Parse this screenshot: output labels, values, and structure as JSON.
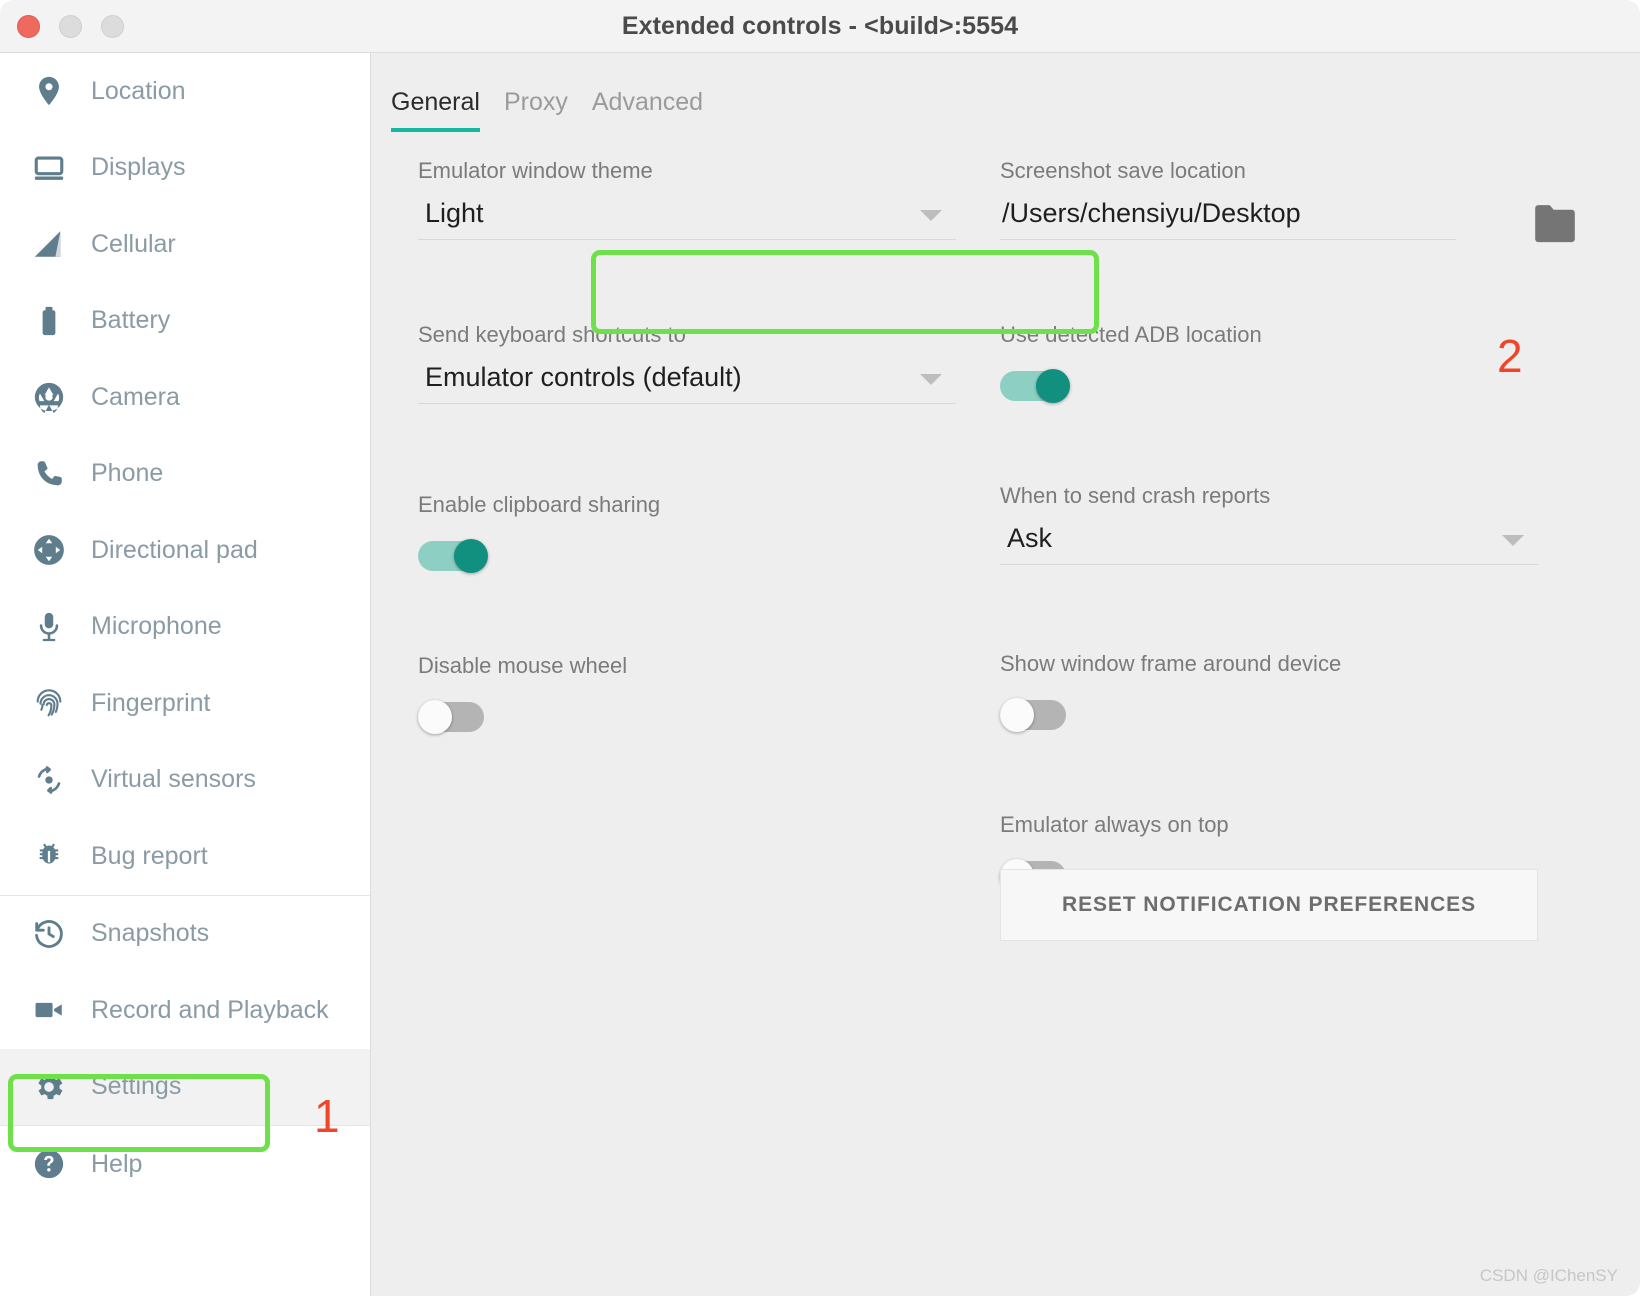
{
  "window": {
    "title": "Extended controls - <build>:5554",
    "traffic_lights": [
      "close-button",
      "minimize-button",
      "maximize-button"
    ]
  },
  "sidebar": {
    "groups": [
      {
        "items": [
          {
            "label": "Location",
            "icon": "location-pin-icon"
          },
          {
            "label": "Displays",
            "icon": "display-icon"
          },
          {
            "label": "Cellular",
            "icon": "cellular-signal-icon"
          },
          {
            "label": "Battery",
            "icon": "battery-icon"
          },
          {
            "label": "Camera",
            "icon": "camera-aperture-icon"
          },
          {
            "label": "Phone",
            "icon": "phone-icon"
          },
          {
            "label": "Directional pad",
            "icon": "dpad-icon"
          },
          {
            "label": "Microphone",
            "icon": "microphone-icon"
          },
          {
            "label": "Fingerprint",
            "icon": "fingerprint-icon"
          },
          {
            "label": "Virtual sensors",
            "icon": "virtual-sensors-icon"
          },
          {
            "label": "Bug report",
            "icon": "bug-icon"
          }
        ]
      },
      {
        "items": [
          {
            "label": "Snapshots",
            "icon": "history-clock-icon"
          },
          {
            "label": "Record and Playback",
            "icon": "video-camera-icon"
          },
          {
            "label": "Settings",
            "icon": "gear-icon",
            "selected": true
          }
        ]
      },
      {
        "items": [
          {
            "label": "Help",
            "icon": "help-question-icon"
          }
        ]
      }
    ]
  },
  "main": {
    "tabs": [
      {
        "label": "General",
        "active": true
      },
      {
        "label": "Proxy",
        "active": false
      },
      {
        "label": "Advanced",
        "active": false
      }
    ],
    "left_column": {
      "theme": {
        "label": "Emulator window theme",
        "value": "Light"
      },
      "keyboard_shortcuts": {
        "label": "Send keyboard shortcuts to",
        "value": "Emulator controls (default)"
      },
      "clipboard_sharing": {
        "label": "Enable clipboard sharing",
        "state": "on"
      },
      "disable_mouse_wheel": {
        "label": "Disable mouse wheel",
        "state": "off"
      }
    },
    "right_column": {
      "screenshot_location": {
        "label": "Screenshot save location",
        "value": "/Users/chensiyu/Desktop",
        "browse_icon": "folder-icon"
      },
      "adb_location": {
        "label": "Use detected ADB location",
        "state": "on"
      },
      "crash_reports": {
        "label": "When to send crash reports",
        "value": "Ask"
      },
      "window_frame": {
        "label": "Show window frame around device",
        "state": "off"
      },
      "always_on_top": {
        "label": "Emulator always on top",
        "state": "off"
      },
      "reset_button": {
        "label": "RESET NOTIFICATION PREFERENCES"
      }
    }
  },
  "annotations": [
    {
      "number": "1",
      "target": "sidebar-item-settings"
    },
    {
      "number": "2",
      "target": "adb-location-toggle"
    }
  ],
  "watermark": "CSDN @IChenSY",
  "colors": {
    "accent_teal": "#12907f",
    "tab_underline": "#14b8a0",
    "highlight_green": "#6ee04a",
    "annotation_red": "#f0452a",
    "sidebar_icon": "#5f7d8c",
    "sidebar_label": "#8a9ba5"
  }
}
